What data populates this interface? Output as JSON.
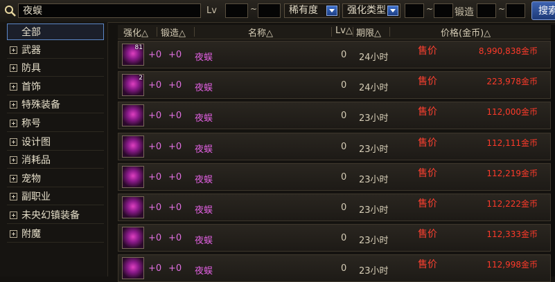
{
  "search": {
    "value": "夜蜈"
  },
  "filters": {
    "lv_label": "Lv",
    "tilde": "~",
    "rarity_label": "稀有度",
    "enhance_type_label": "强化类型",
    "forge_label": "锻造",
    "search_button": "搜索"
  },
  "sidebar": {
    "items": [
      {
        "label": "全部",
        "active": true
      },
      {
        "label": "武器"
      },
      {
        "label": "防具"
      },
      {
        "label": "首饰"
      },
      {
        "label": "特殊装备"
      },
      {
        "label": "称号"
      },
      {
        "label": "设计图"
      },
      {
        "label": "消耗品"
      },
      {
        "label": "宠物"
      },
      {
        "label": "副职业"
      },
      {
        "label": "未央幻镇装备"
      },
      {
        "label": "附魔"
      }
    ]
  },
  "table": {
    "headers": [
      "强化△",
      "锻造△",
      "名称△",
      "Lv△",
      "期限△",
      "价格(金币)△"
    ],
    "sale_label": "售价",
    "rows": [
      {
        "count": "81",
        "enhance": "+0",
        "forge": "+0",
        "name": "夜蜈",
        "lv": "0",
        "period": "24小时",
        "price": "8,990,838金币"
      },
      {
        "count": "2",
        "enhance": "+0",
        "forge": "+0",
        "name": "夜蜈",
        "lv": "0",
        "period": "24小时",
        "price": "223,978金币"
      },
      {
        "count": "",
        "enhance": "+0",
        "forge": "+0",
        "name": "夜蜈",
        "lv": "0",
        "period": "23小时",
        "price": "112,000金币"
      },
      {
        "count": "",
        "enhance": "+0",
        "forge": "+0",
        "name": "夜蜈",
        "lv": "0",
        "period": "23小时",
        "price": "112,111金币"
      },
      {
        "count": "",
        "enhance": "+0",
        "forge": "+0",
        "name": "夜蜈",
        "lv": "0",
        "period": "23小时",
        "price": "112,219金币"
      },
      {
        "count": "",
        "enhance": "+0",
        "forge": "+0",
        "name": "夜蜈",
        "lv": "0",
        "period": "23小时",
        "price": "112,222金币"
      },
      {
        "count": "",
        "enhance": "+0",
        "forge": "+0",
        "name": "夜蜈",
        "lv": "0",
        "period": "23小时",
        "price": "112,333金币"
      },
      {
        "count": "",
        "enhance": "+0",
        "forge": "+0",
        "name": "夜蜈",
        "lv": "0",
        "period": "23小时",
        "price": "112,998金币"
      }
    ]
  }
}
